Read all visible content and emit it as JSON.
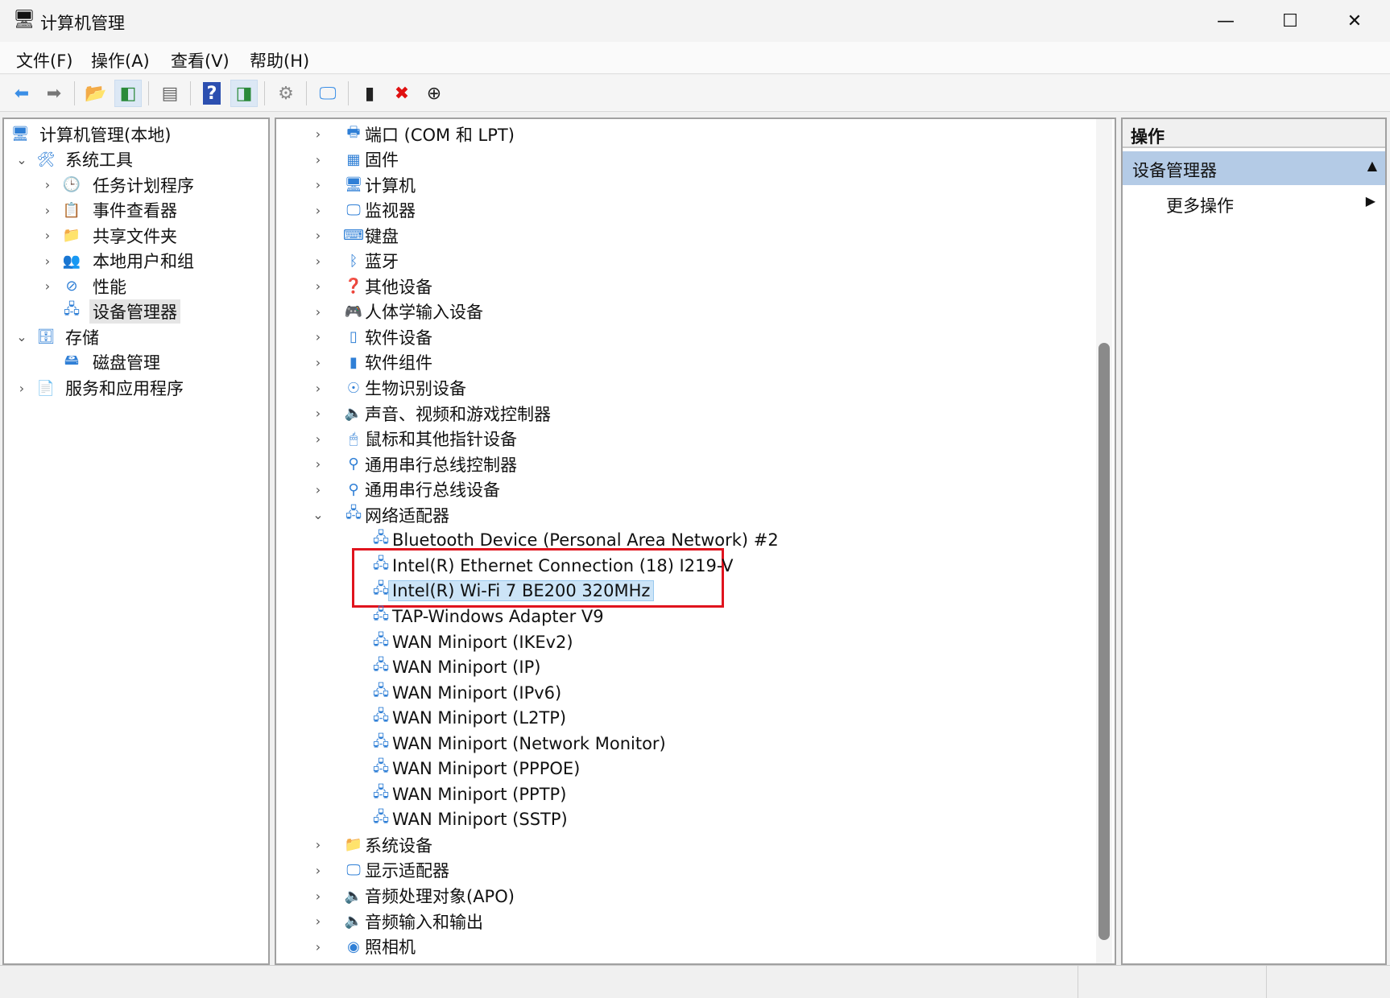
{
  "window": {
    "title": "计算机管理",
    "minimize": "—",
    "maximize": "☐",
    "close": "✕"
  },
  "menu": [
    "文件(F)",
    "操作(A)",
    "查看(V)",
    "帮助(H)"
  ],
  "toolbar": [
    {
      "icon": "back-arrow-icon",
      "glyph": "⬅",
      "color": "#3a8ee6"
    },
    {
      "icon": "forward-arrow-icon",
      "glyph": "➡",
      "color": "#777"
    },
    {
      "sep": true
    },
    {
      "icon": "up-folder-icon",
      "glyph": "📂",
      "color": "#d9a520"
    },
    {
      "icon": "show-hide-console-tree-icon",
      "glyph": "◧",
      "color": "#2a8a3a",
      "on": true
    },
    {
      "sep": true
    },
    {
      "icon": "properties-icon",
      "glyph": "▤",
      "color": "#666"
    },
    {
      "sep": true
    },
    {
      "icon": "help-icon",
      "glyph": "?",
      "color": "#fff",
      "bg": "#2c4fb0"
    },
    {
      "icon": "show-hide-action-pane-icon",
      "glyph": "◨",
      "color": "#2a8a3a",
      "on": true
    },
    {
      "sep": true
    },
    {
      "icon": "update-driver-icon",
      "glyph": "⚙",
      "color": "#888"
    },
    {
      "sep": true
    },
    {
      "icon": "scan-hardware-icon",
      "glyph": "🖵",
      "color": "#3a8ee6"
    },
    {
      "sep": true
    },
    {
      "icon": "enable-device-icon",
      "glyph": "▮",
      "color": "#222"
    },
    {
      "icon": "uninstall-device-icon",
      "glyph": "✖",
      "color": "#e01010"
    },
    {
      "icon": "disable-device-icon",
      "glyph": "⊕",
      "color": "#222"
    }
  ],
  "left_tree": [
    {
      "level": 0,
      "chev": "",
      "icon": "computer-management-icon",
      "glyph": "🖥",
      "label": "计算机管理(本地)"
    },
    {
      "level": 1,
      "chev": "⌄",
      "icon": "system-tools-icon",
      "glyph": "🛠",
      "label": "系统工具"
    },
    {
      "level": 2,
      "chev": "›",
      "icon": "task-scheduler-icon",
      "glyph": "🕒",
      "label": "任务计划程序"
    },
    {
      "level": 2,
      "chev": "›",
      "icon": "event-viewer-icon",
      "glyph": "📋",
      "label": "事件查看器"
    },
    {
      "level": 2,
      "chev": "›",
      "icon": "shared-folders-icon",
      "glyph": "📁",
      "label": "共享文件夹"
    },
    {
      "level": 2,
      "chev": "›",
      "icon": "local-users-groups-icon",
      "glyph": "👥",
      "label": "本地用户和组"
    },
    {
      "level": 2,
      "chev": "›",
      "icon": "performance-icon",
      "glyph": "⊘",
      "label": "性能"
    },
    {
      "level": 2,
      "chev": "",
      "icon": "device-manager-icon",
      "glyph": "🖧",
      "label": "设备管理器",
      "selected": true
    },
    {
      "level": 1,
      "chev": "⌄",
      "icon": "storage-icon",
      "glyph": "🗄",
      "label": "存储"
    },
    {
      "level": 2,
      "chev": "",
      "icon": "disk-management-icon",
      "glyph": "🖴",
      "label": "磁盘管理"
    },
    {
      "level": 1,
      "chev": "›",
      "icon": "services-applications-icon",
      "glyph": "📄",
      "label": "服务和应用程序"
    }
  ],
  "device_tree": [
    {
      "level": 0,
      "chev": "›",
      "icon": "port-icon",
      "glyph": "🖶",
      "label": "端口 (COM 和 LPT)"
    },
    {
      "level": 0,
      "chev": "›",
      "icon": "firmware-icon",
      "glyph": "▦",
      "label": "固件"
    },
    {
      "level": 0,
      "chev": "›",
      "icon": "computer-icon",
      "glyph": "🖥",
      "label": "计算机"
    },
    {
      "level": 0,
      "chev": "›",
      "icon": "monitor-icon",
      "glyph": "🖵",
      "label": "监视器"
    },
    {
      "level": 0,
      "chev": "›",
      "icon": "keyboard-icon",
      "glyph": "⌨",
      "label": "键盘"
    },
    {
      "level": 0,
      "chev": "›",
      "icon": "bluetooth-icon",
      "glyph": "ᛒ",
      "label": "蓝牙"
    },
    {
      "level": 0,
      "chev": "›",
      "icon": "other-devices-icon",
      "glyph": "❓",
      "label": "其他设备"
    },
    {
      "level": 0,
      "chev": "›",
      "icon": "hid-icon",
      "glyph": "🎮",
      "label": "人体学输入设备"
    },
    {
      "level": 0,
      "chev": "›",
      "icon": "software-device-icon",
      "glyph": "▯",
      "label": "软件设备"
    },
    {
      "level": 0,
      "chev": "›",
      "icon": "software-component-icon",
      "glyph": "▮",
      "label": "软件组件"
    },
    {
      "level": 0,
      "chev": "›",
      "icon": "biometric-icon",
      "glyph": "☉",
      "label": "生物识别设备"
    },
    {
      "level": 0,
      "chev": "›",
      "icon": "sound-icon",
      "glyph": "🔈",
      "label": "声音、视频和游戏控制器"
    },
    {
      "level": 0,
      "chev": "›",
      "icon": "mouse-icon",
      "glyph": "🖱",
      "label": "鼠标和其他指针设备"
    },
    {
      "level": 0,
      "chev": "›",
      "icon": "usb-controller-icon",
      "glyph": "⚲",
      "label": "通用串行总线控制器"
    },
    {
      "level": 0,
      "chev": "›",
      "icon": "usb-device-icon",
      "glyph": "⚲",
      "label": "通用串行总线设备"
    },
    {
      "level": 0,
      "chev": "⌄",
      "icon": "network-adapter-icon",
      "glyph": "🖧",
      "label": "网络适配器"
    },
    {
      "level": 1,
      "icon": "network-adapter-icon",
      "glyph": "🖧",
      "label": "Bluetooth Device (Personal Area Network) #2"
    },
    {
      "level": 1,
      "icon": "network-adapter-icon",
      "glyph": "🖧",
      "label": "Intel(R) Ethernet Connection (18) I219-V"
    },
    {
      "level": 1,
      "icon": "network-adapter-icon",
      "glyph": "🖧",
      "label": "Intel(R) Wi-Fi 7 BE200 320MHz",
      "selected": true
    },
    {
      "level": 1,
      "icon": "network-adapter-icon",
      "glyph": "🖧",
      "label": "TAP-Windows Adapter V9"
    },
    {
      "level": 1,
      "icon": "network-adapter-icon",
      "glyph": "🖧",
      "label": "WAN Miniport (IKEv2)"
    },
    {
      "level": 1,
      "icon": "network-adapter-icon",
      "glyph": "🖧",
      "label": "WAN Miniport (IP)"
    },
    {
      "level": 1,
      "icon": "network-adapter-icon",
      "glyph": "🖧",
      "label": "WAN Miniport (IPv6)"
    },
    {
      "level": 1,
      "icon": "network-adapter-icon",
      "glyph": "🖧",
      "label": "WAN Miniport (L2TP)"
    },
    {
      "level": 1,
      "icon": "network-adapter-icon",
      "glyph": "🖧",
      "label": "WAN Miniport (Network Monitor)"
    },
    {
      "level": 1,
      "icon": "network-adapter-icon",
      "glyph": "🖧",
      "label": "WAN Miniport (PPPOE)"
    },
    {
      "level": 1,
      "icon": "network-adapter-icon",
      "glyph": "🖧",
      "label": "WAN Miniport (PPTP)"
    },
    {
      "level": 1,
      "icon": "network-adapter-icon",
      "glyph": "🖧",
      "label": "WAN Miniport (SSTP)"
    },
    {
      "level": 0,
      "chev": "›",
      "icon": "system-devices-icon",
      "glyph": "📁",
      "label": "系统设备"
    },
    {
      "level": 0,
      "chev": "›",
      "icon": "display-adapter-icon",
      "glyph": "🖵",
      "label": "显示适配器"
    },
    {
      "level": 0,
      "chev": "›",
      "icon": "audio-processing-icon",
      "glyph": "🔈",
      "label": "音频处理对象(APO)"
    },
    {
      "level": 0,
      "chev": "›",
      "icon": "audio-io-icon",
      "glyph": "🔈",
      "label": "音频输入和输出"
    },
    {
      "level": 0,
      "chev": "›",
      "icon": "camera-icon",
      "glyph": "◉",
      "label": "照相机"
    }
  ],
  "actions": {
    "header": "操作",
    "section": "设备管理器",
    "more": "更多操作"
  },
  "colors": {
    "highlight_box": "#e0141e",
    "selection": "#cce4f7",
    "action_section": "#b4cbe6"
  }
}
